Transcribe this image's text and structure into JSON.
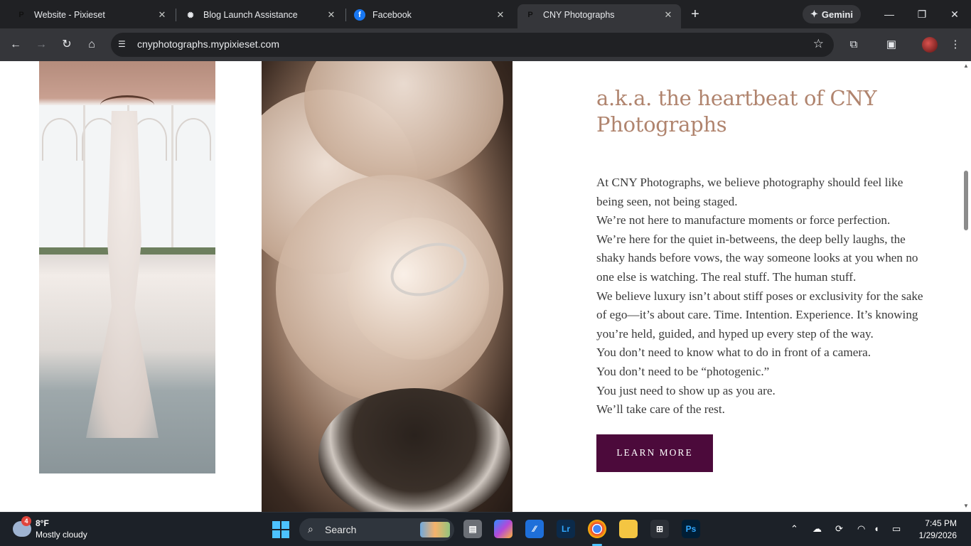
{
  "browser": {
    "tabs": [
      {
        "title": "Website - Pixieset",
        "favicon": "P"
      },
      {
        "title": "Blog Launch Assistance",
        "favicon": "chatgpt-icon"
      },
      {
        "title": "Facebook",
        "favicon": "f"
      },
      {
        "title": "CNY Photographs",
        "favicon": "P",
        "active": true
      }
    ],
    "gemini_label": "Gemini",
    "url": "cnyphotographs.mypixieset.com"
  },
  "page": {
    "heading": "a.k.a. the heartbeat of CNY Photographs",
    "paragraphs": [
      "At CNY Photographs, we believe photography should feel like being seen, not being staged.",
      "We’re not here to manufacture moments or force perfection.",
      "We’re here for the quiet in-betweens, the deep belly laughs, the shaky hands before vows, the way someone looks at you when no one else is watching. The real stuff. The human stuff.",
      "We believe luxury isn’t about stiff poses or exclusivity for the sake of ego—it’s about care. Time. Intention. Experience. It’s knowing you’re held, guided, and hyped up every step of the way.",
      "You don’t need to know what to do in front of a camera.",
      "You don’t need to be “photogenic.”",
      "You just need to show up as you are.",
      "We’ll take care of the rest."
    ],
    "cta_label": "LEARN MORE",
    "accent_color": "#4c0a3b",
    "heading_color": "#b0846e"
  },
  "taskbar": {
    "weather_temp": "8°F",
    "weather_desc": "Mostly cloudy",
    "weather_badge": "4",
    "search_label": "Search",
    "time": "7:45 PM",
    "date": "1/29/2026"
  }
}
